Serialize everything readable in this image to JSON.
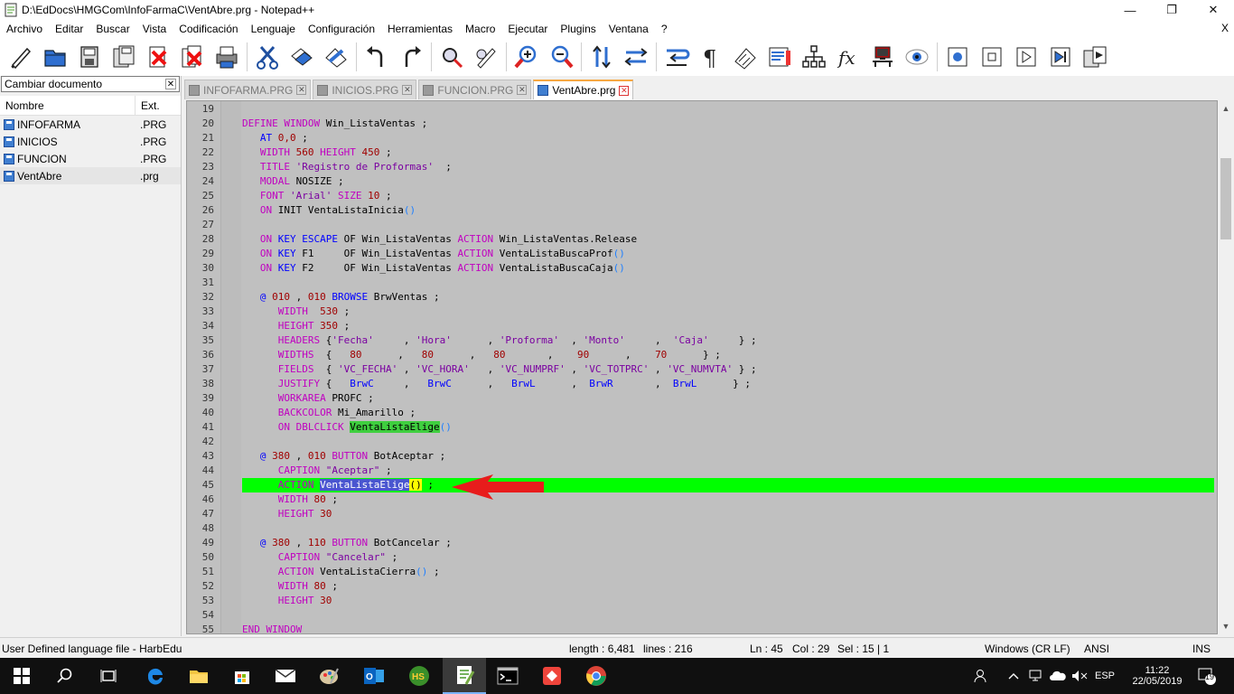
{
  "window": {
    "title": "D:\\EdDocs\\HMGCom\\InfoFarmaC\\VentAbre.prg - Notepad++",
    "minimize": "—",
    "maximize": "❐",
    "close": "✕"
  },
  "menu": {
    "items": [
      "Archivo",
      "Editar",
      "Buscar",
      "Vista",
      "Codificación",
      "Lenguaje",
      "Configuración",
      "Herramientas",
      "Macro",
      "Ejecutar",
      "Plugins",
      "Ventana",
      "?"
    ],
    "close_doc": "X"
  },
  "toolbar": {
    "icons": [
      "new-file-icon",
      "open-file-icon",
      "save-icon",
      "save-all-icon",
      "close-icon",
      "close-all-icon",
      "print-icon",
      "cut-icon",
      "copy-icon",
      "paste-icon",
      "undo-icon",
      "redo-icon",
      "find-icon",
      "replace-icon",
      "zoom-in-icon",
      "zoom-out-icon",
      "sync-vertical-icon",
      "sync-horizontal-icon",
      "word-wrap-icon",
      "show-all-chars-icon",
      "indent-guide-icon",
      "language-icon",
      "document-map-icon",
      "function-list-icon",
      "folder-workspace-icon",
      "monitoring-icon",
      "record-macro-icon",
      "stop-macro-icon",
      "play-macro-icon",
      "run-macro-multiple-icon",
      "save-macro-icon"
    ]
  },
  "doc_switcher": {
    "title": "Cambiar documento",
    "col_name": "Nombre",
    "col_ext": "Ext.",
    "files": [
      {
        "name": "INFOFARMA",
        "ext": ".PRG"
      },
      {
        "name": "INICIOS",
        "ext": ".PRG"
      },
      {
        "name": "FUNCION",
        "ext": ".PRG"
      },
      {
        "name": "VentAbre",
        "ext": ".prg"
      }
    ]
  },
  "tabs": [
    {
      "label": "INFOFARMA.PRG"
    },
    {
      "label": "INICIOS.PRG"
    },
    {
      "label": "FUNCION.PRG"
    },
    {
      "label": "VentAbre.prg"
    }
  ],
  "editor": {
    "line_numbers": [
      "19",
      "20",
      "21",
      "22",
      "23",
      "24",
      "25",
      "26",
      "27",
      "28",
      "29",
      "30",
      "31",
      "32",
      "33",
      "34",
      "35",
      "36",
      "37",
      "38",
      "39",
      "40",
      "41",
      "42",
      "43",
      "44",
      "45",
      "46",
      "47",
      "48",
      "49",
      "50",
      "51",
      "52",
      "53",
      "54",
      "55"
    ]
  },
  "status": {
    "language": "User Defined language file - HarbEdu",
    "length": "length : 6,481",
    "lines": "lines : 216",
    "ln": "Ln : 45",
    "col": "Col : 29",
    "sel": "Sel : 15 | 1",
    "eol": "Windows (CR LF)",
    "encoding": "ANSI",
    "mode": "INS"
  },
  "taskbar": {
    "language": "ESP",
    "time": "11:22",
    "date": "22/05/2019",
    "notifications": "19"
  },
  "colors": {
    "current_line": "#00ff00",
    "keyword": "#c000c0",
    "keyword2": "#0000ff",
    "annotation_arrow": "#e81c1c"
  }
}
